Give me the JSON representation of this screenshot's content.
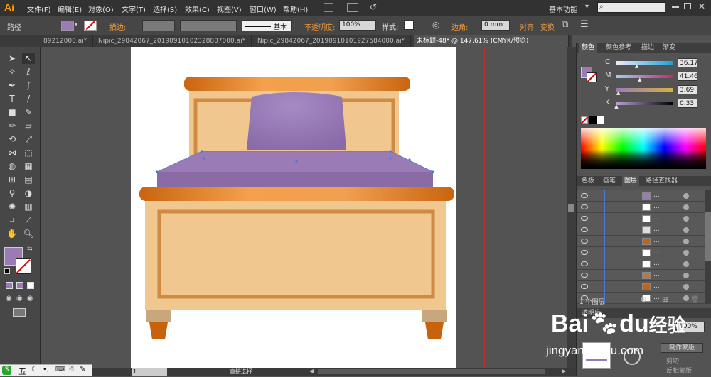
{
  "app": {
    "logo": "Ai",
    "menus": [
      "文件(F)",
      "编辑(E)",
      "对象(O)",
      "文字(T)",
      "选择(S)",
      "效果(C)",
      "视图(V)",
      "窗口(W)",
      "帮助(H)"
    ],
    "workspace": "基本功能"
  },
  "control_bar": {
    "object_type": "路径",
    "stroke_label": "描边:",
    "stroke_style": "基本",
    "opacity_label": "不透明度:",
    "opacity_value": "100%",
    "style_label": "样式:",
    "corner_label": "边角:",
    "corner_value": "0 mm",
    "align_label": "对齐",
    "transform_label": "变换",
    "fill_color": "#9b7bb5"
  },
  "tabs": [
    {
      "label": "89212000.ai*",
      "active": false
    },
    {
      "label": "Nipic_29842067_20190910102328807000.ai*",
      "active": false
    },
    {
      "label": "Nipic_29842067_20190910101927584000.ai*",
      "active": false
    },
    {
      "label": "未标题-48* @ 147.61% (CMYK/预览)",
      "active": true
    }
  ],
  "color_panel": {
    "tabs": [
      "颜色",
      "颜色参考",
      "描边",
      "渐变"
    ],
    "channels": [
      {
        "name": "C",
        "value": "36.17",
        "fraction": 0.3617
      },
      {
        "name": "M",
        "value": "41.46",
        "fraction": 0.4146
      },
      {
        "name": "Y",
        "value": "3.69",
        "fraction": 0.0369
      },
      {
        "name": "K",
        "value": "0.33",
        "fraction": 0.0033
      }
    ]
  },
  "layers_panel": {
    "tabs": [
      "色板",
      "画笔",
      "图层",
      "路径查找器"
    ],
    "rows": [
      {
        "name": "...",
        "thumb": "#9b7bb5"
      },
      {
        "name": "...",
        "thumb": "#ffffff"
      },
      {
        "name": "...",
        "thumb": "#ffffff"
      },
      {
        "name": "...",
        "thumb": "#dddddd"
      },
      {
        "name": "...",
        "thumb": "#c8620c"
      },
      {
        "name": "...",
        "thumb": "#ffffff"
      },
      {
        "name": "...",
        "thumb": "#ffffff"
      },
      {
        "name": "...",
        "thumb": "#b87a44"
      },
      {
        "name": "...",
        "thumb": "#c8620c"
      },
      {
        "name": "...",
        "thumb": "#ffffff"
      }
    ],
    "footer": "1 个图层"
  },
  "transparency_panel": {
    "title": "透明度",
    "opacity_value": "100%",
    "make_mask": "制作蒙版",
    "clip": "剪切",
    "invert_mask": "反相蒙版"
  },
  "status": {
    "zoom": "1",
    "tool": "直接选择"
  },
  "watermark": {
    "brand": "Bai",
    "brand2": "du",
    "brand_cn": "经验",
    "url": "jingyan.baidu.com"
  },
  "taskbar": {
    "ime": "五"
  },
  "colors": {
    "accent": "#f29b38",
    "bed_wood": "#d77a1f",
    "bed_panel": "#f0c78f",
    "bed_inner_border": "#cf8b43",
    "mattress": "#9b7bb5",
    "pillow": "#9a7db8"
  }
}
